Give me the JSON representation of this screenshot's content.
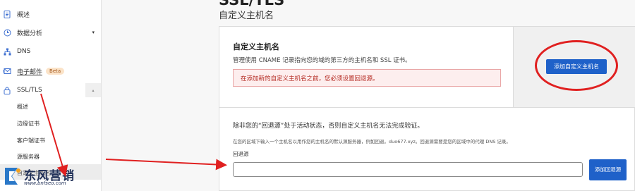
{
  "sidebar": {
    "items": [
      {
        "label": "概述",
        "icon": "document-icon"
      },
      {
        "label": "数据分析",
        "icon": "chart-clock-icon",
        "caret": "▾"
      },
      {
        "label": "DNS",
        "icon": "network-icon"
      },
      {
        "label": "电子邮件",
        "icon": "email-icon",
        "badge": "Beta"
      },
      {
        "label": "SSL/TLS",
        "icon": "lock-icon",
        "caret": "▴"
      }
    ],
    "sub_items": [
      "概述",
      "边缘证书",
      "客户端证书",
      "源服务器",
      "自定义主机名"
    ]
  },
  "watermark": {
    "text": "东风营销",
    "url": "www.bnfseo.com"
  },
  "page": {
    "title": "SSL/TLS",
    "subtitle": "自定义主机名"
  },
  "custom_hostnames": {
    "title": "自定义主机名",
    "description": "管理使用 CNAME 记录指向您的域的第三方的主机名和 SSL 证书。",
    "warning": "在添加新的自定义主机名之前，您必须设置回退源。",
    "add_button": "添加自定义主机名"
  },
  "fallback": {
    "note": "除非您的“回退源”处于活动状态，否则自定义主机名无法完成验证。",
    "hint": "在您的区域下输入一个主机名以用作您的主机名的默认源服务器，例如回退。duo677.xyz。回退源需要是您的区域中的代理 DNS 记录。",
    "label": "回退源",
    "input_value": "",
    "input_placeholder": "",
    "button": "添加回退源"
  },
  "colors": {
    "accent": "#1f61c9",
    "warning": "#b3261e",
    "annotation": "#e02020"
  }
}
